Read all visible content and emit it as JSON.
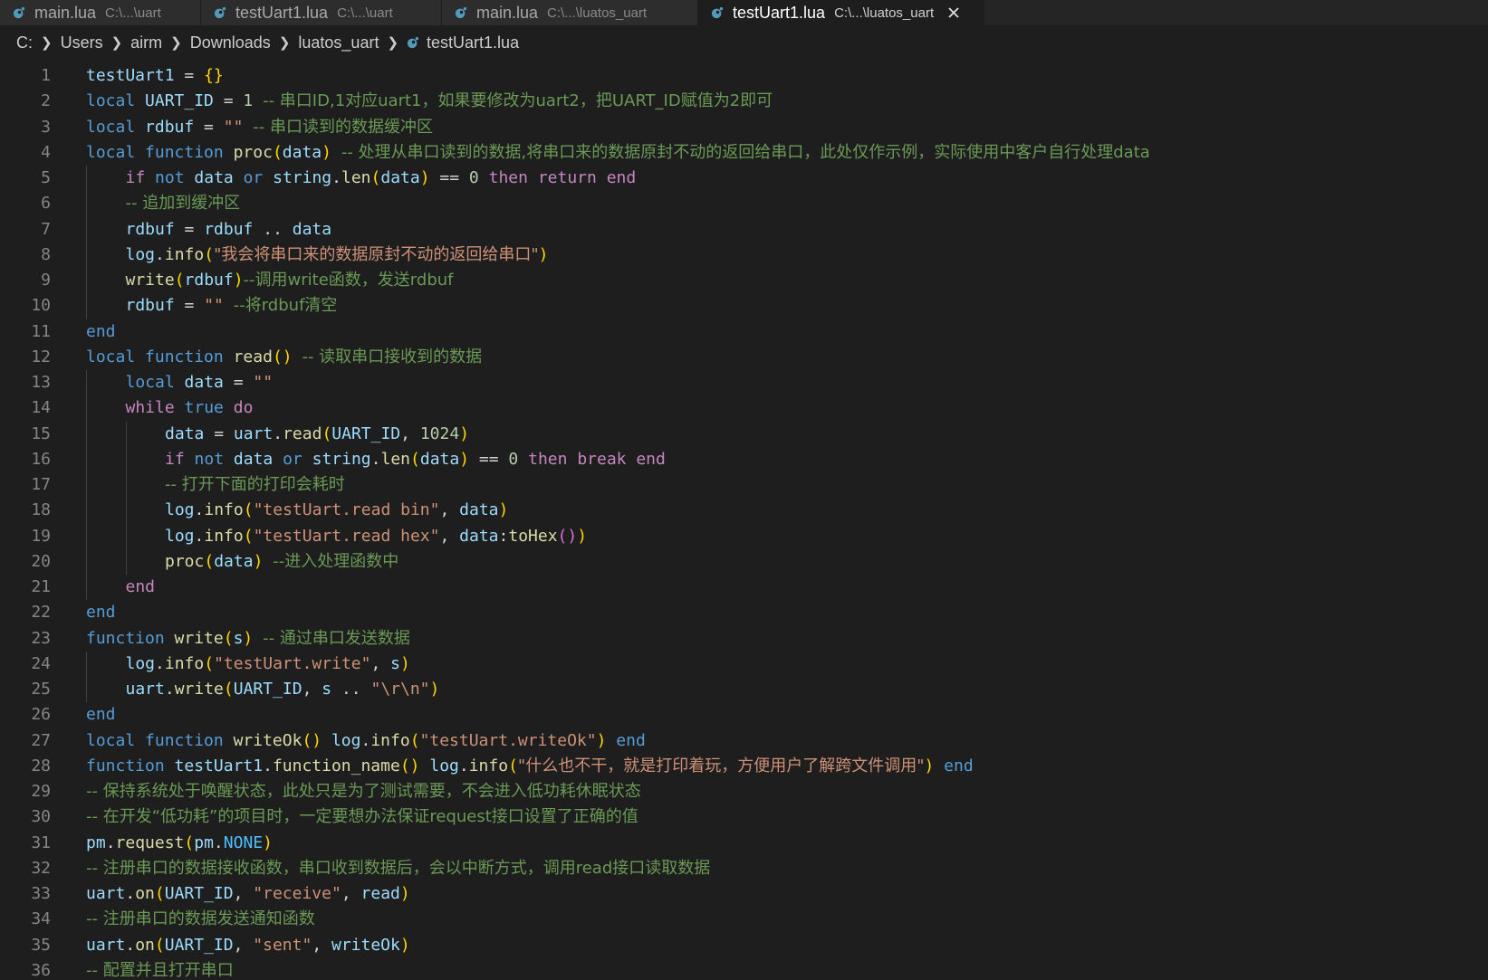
{
  "tabs": [
    {
      "name": "main.lua",
      "path": "C:\\...\\uart",
      "active": false
    },
    {
      "name": "testUart1.lua",
      "path": "C:\\...\\uart",
      "active": false
    },
    {
      "name": "main.lua",
      "path": "C:\\...\\luatos_uart",
      "active": false
    },
    {
      "name": "testUart1.lua",
      "path": "C:\\...\\luatos_uart",
      "active": true
    }
  ],
  "breadcrumb": {
    "items": [
      "C:",
      "Users",
      "airm",
      "Downloads",
      "luatos_uart"
    ],
    "file": "testUart1.lua"
  },
  "colors": {
    "keyword": "#569cd6",
    "control": "#c586c0",
    "function": "#dcdcaa",
    "variable": "#9cdcfe",
    "string": "#ce9178",
    "number": "#b5cea8",
    "comment": "#6a9955",
    "lua_icon": "#519aba"
  },
  "code": {
    "lines": [
      {
        "n": "1",
        "indent": 0,
        "tokens": [
          [
            "var",
            "testUart1"
          ],
          [
            "op",
            " = "
          ],
          [
            "br1",
            "{}"
          ]
        ]
      },
      {
        "n": "2",
        "indent": 0,
        "tokens": [
          [
            "kw",
            "local"
          ],
          [
            "op",
            " "
          ],
          [
            "var",
            "UART_ID"
          ],
          [
            "op",
            " = "
          ],
          [
            "num",
            "1"
          ],
          [
            "op",
            " "
          ],
          [
            "cm",
            "-- 串口ID,1对应uart1，如果要修改为uart2，把UART_ID赋值为2即可"
          ]
        ]
      },
      {
        "n": "3",
        "indent": 0,
        "tokens": [
          [
            "kw",
            "local"
          ],
          [
            "op",
            " "
          ],
          [
            "var",
            "rdbuf"
          ],
          [
            "op",
            " = "
          ],
          [
            "str",
            "\"\""
          ],
          [
            "op",
            " "
          ],
          [
            "cm",
            "-- 串口读到的数据缓冲区"
          ]
        ]
      },
      {
        "n": "4",
        "indent": 0,
        "tokens": [
          [
            "kw",
            "local"
          ],
          [
            "op",
            " "
          ],
          [
            "kw",
            "function"
          ],
          [
            "op",
            " "
          ],
          [
            "fn",
            "proc"
          ],
          [
            "br1",
            "("
          ],
          [
            "var",
            "data"
          ],
          [
            "br1",
            ")"
          ],
          [
            "op",
            " "
          ],
          [
            "cm",
            "-- 处理从串口读到的数据,将串口来的数据原封不动的返回给串口，此处仅作示例，实际使用中客户自行处理data"
          ]
        ]
      },
      {
        "n": "5",
        "indent": 1,
        "tokens": [
          [
            "ctl",
            "if"
          ],
          [
            "op",
            " "
          ],
          [
            "kw",
            "not"
          ],
          [
            "op",
            " "
          ],
          [
            "var",
            "data"
          ],
          [
            "op",
            " "
          ],
          [
            "kw",
            "or"
          ],
          [
            "op",
            " "
          ],
          [
            "var",
            "string"
          ],
          [
            "op",
            "."
          ],
          [
            "fn",
            "len"
          ],
          [
            "br1",
            "("
          ],
          [
            "var",
            "data"
          ],
          [
            "br1",
            ")"
          ],
          [
            "op",
            " == "
          ],
          [
            "num",
            "0"
          ],
          [
            "op",
            " "
          ],
          [
            "ctl",
            "then"
          ],
          [
            "op",
            " "
          ],
          [
            "ctl",
            "return"
          ],
          [
            "op",
            " "
          ],
          [
            "ctl",
            "end"
          ]
        ]
      },
      {
        "n": "6",
        "indent": 1,
        "tokens": [
          [
            "cm",
            "-- 追加到缓冲区"
          ]
        ]
      },
      {
        "n": "7",
        "indent": 1,
        "tokens": [
          [
            "var",
            "rdbuf"
          ],
          [
            "op",
            " = "
          ],
          [
            "var",
            "rdbuf"
          ],
          [
            "op",
            " .. "
          ],
          [
            "var",
            "data"
          ]
        ]
      },
      {
        "n": "8",
        "indent": 1,
        "tokens": [
          [
            "var",
            "log"
          ],
          [
            "op",
            "."
          ],
          [
            "fn",
            "info"
          ],
          [
            "br1",
            "("
          ],
          [
            "str",
            "\"我会将串口来的数据原封不动的返回给串口\""
          ],
          [
            "br1",
            ")"
          ]
        ]
      },
      {
        "n": "9",
        "indent": 1,
        "tokens": [
          [
            "fn",
            "write"
          ],
          [
            "br1",
            "("
          ],
          [
            "var",
            "rdbuf"
          ],
          [
            "br1",
            ")"
          ],
          [
            "cm",
            "--调用write函数，发送rdbuf"
          ]
        ]
      },
      {
        "n": "10",
        "indent": 1,
        "tokens": [
          [
            "var",
            "rdbuf"
          ],
          [
            "op",
            " = "
          ],
          [
            "str",
            "\"\""
          ],
          [
            "op",
            " "
          ],
          [
            "cm",
            "--将rdbuf清空"
          ]
        ]
      },
      {
        "n": "11",
        "indent": 0,
        "tokens": [
          [
            "kw",
            "end"
          ]
        ]
      },
      {
        "n": "12",
        "indent": 0,
        "tokens": [
          [
            "kw",
            "local"
          ],
          [
            "op",
            " "
          ],
          [
            "kw",
            "function"
          ],
          [
            "op",
            " "
          ],
          [
            "fn",
            "read"
          ],
          [
            "br1",
            "()"
          ],
          [
            "op",
            " "
          ],
          [
            "cm",
            "-- 读取串口接收到的数据"
          ]
        ]
      },
      {
        "n": "13",
        "indent": 1,
        "tokens": [
          [
            "kw",
            "local"
          ],
          [
            "op",
            " "
          ],
          [
            "var",
            "data"
          ],
          [
            "op",
            " = "
          ],
          [
            "str",
            "\"\""
          ]
        ]
      },
      {
        "n": "14",
        "indent": 1,
        "tokens": [
          [
            "ctl",
            "while"
          ],
          [
            "op",
            " "
          ],
          [
            "kw",
            "true"
          ],
          [
            "op",
            " "
          ],
          [
            "ctl",
            "do"
          ]
        ]
      },
      {
        "n": "15",
        "indent": 2,
        "tokens": [
          [
            "var",
            "data"
          ],
          [
            "op",
            " = "
          ],
          [
            "var",
            "uart"
          ],
          [
            "op",
            "."
          ],
          [
            "fn",
            "read"
          ],
          [
            "br1",
            "("
          ],
          [
            "var",
            "UART_ID"
          ],
          [
            "op",
            ", "
          ],
          [
            "num",
            "1024"
          ],
          [
            "br1",
            ")"
          ]
        ]
      },
      {
        "n": "16",
        "indent": 2,
        "tokens": [
          [
            "ctl",
            "if"
          ],
          [
            "op",
            " "
          ],
          [
            "kw",
            "not"
          ],
          [
            "op",
            " "
          ],
          [
            "var",
            "data"
          ],
          [
            "op",
            " "
          ],
          [
            "kw",
            "or"
          ],
          [
            "op",
            " "
          ],
          [
            "var",
            "string"
          ],
          [
            "op",
            "."
          ],
          [
            "fn",
            "len"
          ],
          [
            "br1",
            "("
          ],
          [
            "var",
            "data"
          ],
          [
            "br1",
            ")"
          ],
          [
            "op",
            " == "
          ],
          [
            "num",
            "0"
          ],
          [
            "op",
            " "
          ],
          [
            "ctl",
            "then"
          ],
          [
            "op",
            " "
          ],
          [
            "ctl",
            "break"
          ],
          [
            "op",
            " "
          ],
          [
            "ctl",
            "end"
          ]
        ]
      },
      {
        "n": "17",
        "indent": 2,
        "tokens": [
          [
            "cm",
            "-- 打开下面的打印会耗时"
          ]
        ]
      },
      {
        "n": "18",
        "indent": 2,
        "tokens": [
          [
            "var",
            "log"
          ],
          [
            "op",
            "."
          ],
          [
            "fn",
            "info"
          ],
          [
            "br1",
            "("
          ],
          [
            "str",
            "\"testUart.read bin\""
          ],
          [
            "op",
            ", "
          ],
          [
            "var",
            "data"
          ],
          [
            "br1",
            ")"
          ]
        ]
      },
      {
        "n": "19",
        "indent": 2,
        "tokens": [
          [
            "var",
            "log"
          ],
          [
            "op",
            "."
          ],
          [
            "fn",
            "info"
          ],
          [
            "br1",
            "("
          ],
          [
            "str",
            "\"testUart.read hex\""
          ],
          [
            "op",
            ", "
          ],
          [
            "var",
            "data"
          ],
          [
            "op",
            ":"
          ],
          [
            "fn",
            "toHex"
          ],
          [
            "br2",
            "()"
          ],
          [
            "br1",
            ")"
          ]
        ]
      },
      {
        "n": "20",
        "indent": 2,
        "tokens": [
          [
            "fn",
            "proc"
          ],
          [
            "br1",
            "("
          ],
          [
            "var",
            "data"
          ],
          [
            "br1",
            ")"
          ],
          [
            "op",
            " "
          ],
          [
            "cm",
            "--进入处理函数中"
          ]
        ]
      },
      {
        "n": "21",
        "indent": 1,
        "tokens": [
          [
            "ctl",
            "end"
          ]
        ]
      },
      {
        "n": "22",
        "indent": 0,
        "tokens": [
          [
            "kw",
            "end"
          ]
        ]
      },
      {
        "n": "23",
        "indent": 0,
        "tokens": [
          [
            "kw",
            "function"
          ],
          [
            "op",
            " "
          ],
          [
            "fn",
            "write"
          ],
          [
            "br1",
            "("
          ],
          [
            "var",
            "s"
          ],
          [
            "br1",
            ")"
          ],
          [
            "op",
            " "
          ],
          [
            "cm",
            "-- 通过串口发送数据"
          ]
        ]
      },
      {
        "n": "24",
        "indent": 1,
        "tokens": [
          [
            "var",
            "log"
          ],
          [
            "op",
            "."
          ],
          [
            "fn",
            "info"
          ],
          [
            "br1",
            "("
          ],
          [
            "str",
            "\"testUart.write\""
          ],
          [
            "op",
            ", "
          ],
          [
            "var",
            "s"
          ],
          [
            "br1",
            ")"
          ]
        ]
      },
      {
        "n": "25",
        "indent": 1,
        "tokens": [
          [
            "var",
            "uart"
          ],
          [
            "op",
            "."
          ],
          [
            "fn",
            "write"
          ],
          [
            "br1",
            "("
          ],
          [
            "var",
            "UART_ID"
          ],
          [
            "op",
            ", "
          ],
          [
            "var",
            "s"
          ],
          [
            "op",
            " .. "
          ],
          [
            "str",
            "\"\\r\\n\""
          ],
          [
            "br1",
            ")"
          ]
        ]
      },
      {
        "n": "26",
        "indent": 0,
        "tokens": [
          [
            "kw",
            "end"
          ]
        ]
      },
      {
        "n": "27",
        "indent": 0,
        "tokens": [
          [
            "kw",
            "local"
          ],
          [
            "op",
            " "
          ],
          [
            "kw",
            "function"
          ],
          [
            "op",
            " "
          ],
          [
            "fn",
            "writeOk"
          ],
          [
            "br1",
            "()"
          ],
          [
            "op",
            " "
          ],
          [
            "var",
            "log"
          ],
          [
            "op",
            "."
          ],
          [
            "fn",
            "info"
          ],
          [
            "br1",
            "("
          ],
          [
            "str",
            "\"testUart.writeOk\""
          ],
          [
            "br1",
            ")"
          ],
          [
            "op",
            " "
          ],
          [
            "kw",
            "end"
          ]
        ]
      },
      {
        "n": "28",
        "indent": 0,
        "tokens": [
          [
            "kw",
            "function"
          ],
          [
            "op",
            " "
          ],
          [
            "var",
            "testUart1"
          ],
          [
            "op",
            "."
          ],
          [
            "fn",
            "function_name"
          ],
          [
            "br1",
            "()"
          ],
          [
            "op",
            " "
          ],
          [
            "var",
            "log"
          ],
          [
            "op",
            "."
          ],
          [
            "fn",
            "info"
          ],
          [
            "br1",
            "("
          ],
          [
            "str",
            "\"什么也不干，就是打印着玩，方便用户了解跨文件调用\""
          ],
          [
            "br1",
            ")"
          ],
          [
            "op",
            " "
          ],
          [
            "kw",
            "end"
          ]
        ]
      },
      {
        "n": "29",
        "indent": 0,
        "tokens": [
          [
            "cm",
            "-- 保持系统处于唤醒状态，此处只是为了测试需要，不会进入低功耗休眠状态"
          ]
        ]
      },
      {
        "n": "30",
        "indent": 0,
        "tokens": [
          [
            "cm",
            "-- 在开发“低功耗”的项目时，一定要想办法保证request接口设置了正确的值"
          ]
        ]
      },
      {
        "n": "31",
        "indent": 0,
        "tokens": [
          [
            "var",
            "pm"
          ],
          [
            "op",
            "."
          ],
          [
            "fn",
            "request"
          ],
          [
            "br1",
            "("
          ],
          [
            "var",
            "pm"
          ],
          [
            "op",
            "."
          ],
          [
            "const",
            "NONE"
          ],
          [
            "br1",
            ")"
          ]
        ]
      },
      {
        "n": "32",
        "indent": 0,
        "tokens": [
          [
            "cm",
            "-- 注册串口的数据接收函数，串口收到数据后，会以中断方式，调用read接口读取数据"
          ]
        ]
      },
      {
        "n": "33",
        "indent": 0,
        "tokens": [
          [
            "var",
            "uart"
          ],
          [
            "op",
            "."
          ],
          [
            "fn",
            "on"
          ],
          [
            "br1",
            "("
          ],
          [
            "var",
            "UART_ID"
          ],
          [
            "op",
            ", "
          ],
          [
            "str",
            "\"receive\""
          ],
          [
            "op",
            ", "
          ],
          [
            "var",
            "read"
          ],
          [
            "br1",
            ")"
          ]
        ]
      },
      {
        "n": "34",
        "indent": 0,
        "tokens": [
          [
            "cm",
            "-- 注册串口的数据发送通知函数"
          ]
        ]
      },
      {
        "n": "35",
        "indent": 0,
        "tokens": [
          [
            "var",
            "uart"
          ],
          [
            "op",
            "."
          ],
          [
            "fn",
            "on"
          ],
          [
            "br1",
            "("
          ],
          [
            "var",
            "UART_ID"
          ],
          [
            "op",
            ", "
          ],
          [
            "str",
            "\"sent\""
          ],
          [
            "op",
            ", "
          ],
          [
            "var",
            "writeOk"
          ],
          [
            "br1",
            ")"
          ]
        ]
      },
      {
        "n": "36",
        "indent": 0,
        "tokens": [
          [
            "cm",
            "-- 配置并且打开串口"
          ]
        ]
      }
    ]
  }
}
